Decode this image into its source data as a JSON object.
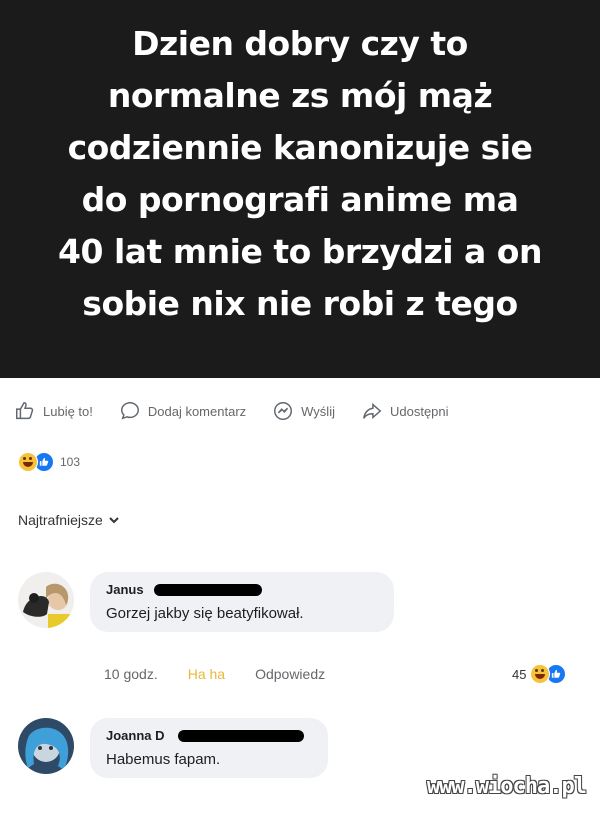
{
  "post": {
    "lines": [
      "Dzien dobry czy to",
      "normalne zs mój mąż",
      "codziennie kanonizuje sie",
      "do pornografi anime ma",
      "40 lat mnie to brzydzi a on",
      "sobie nix nie robi z tego"
    ],
    "background": "#1b1b1b"
  },
  "actions": {
    "like": "Lubię to!",
    "comment": "Dodaj komentarz",
    "send": "Wyślij",
    "share": "Udostępni"
  },
  "reactions": {
    "count": "103",
    "icons": [
      "haha-icon",
      "like-icon"
    ]
  },
  "sort": {
    "label": "Najtrafniejsze"
  },
  "comments": [
    {
      "author": "Janus",
      "text": "Gorzej jakby się beatyfikował.",
      "time": "10 godz.",
      "reaction_link": "Ha ha",
      "reply": "Odpowiedz",
      "reaction_count": "45"
    },
    {
      "author": "Joanna D",
      "text": "Habemus fapam."
    }
  ],
  "watermark": "www.wiocha.pl",
  "colors": {
    "reaction_haha_link": "#e8b93a",
    "muted": "#65676b",
    "accent": "#1877f2"
  }
}
